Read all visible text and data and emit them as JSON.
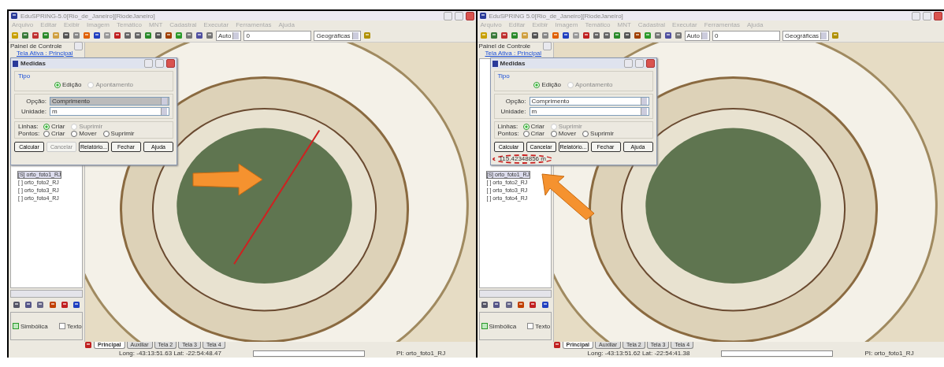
{
  "panels": [
    {
      "window": {
        "title": "EduSPRING-5.0[Rio_de_Janeiro][RiodeJaneiro]"
      },
      "menu": [
        "Arquivo",
        "Editar",
        "Exibir",
        "Imagem",
        "Temático",
        "MNT",
        "Cadastral",
        "Executar",
        "Ferramentas",
        "Ajuda"
      ],
      "toolbar": {
        "scale": "Auto",
        "value": "0",
        "projection": "Geográficas"
      },
      "control_panel": {
        "title": "Painel de Controle",
        "active_screen": "Tela Ativa : Principal",
        "layers": [
          {
            "label": "[S] orto_foto1_RJ",
            "selected": true
          },
          {
            "label": "[ ] orto_foto2_RJ",
            "selected": false
          },
          {
            "label": "[ ] orto_foto3_RJ",
            "selected": false
          },
          {
            "label": "[ ] orto_foto4_RJ",
            "selected": false
          }
        ],
        "options": [
          {
            "label": "Simbólica",
            "checked": true
          },
          {
            "label": "Texto",
            "checked": false
          }
        ]
      },
      "dialog": {
        "title": "Medidas",
        "group_title": "Tipo",
        "type_options": [
          {
            "label": "Edição",
            "selected": true,
            "disabled": false
          },
          {
            "label": "Apontamento",
            "selected": false,
            "disabled": true
          }
        ],
        "fields": [
          {
            "label": "Opção:",
            "value": "Comprimento",
            "focused": true
          },
          {
            "label": "Unidade:",
            "value": "m",
            "focused": false
          }
        ],
        "rows": [
          {
            "label": "Linhas:",
            "options": [
              {
                "label": "Criar",
                "selected": true,
                "disabled": false
              },
              {
                "label": "Suprimir",
                "selected": false,
                "disabled": true
              }
            ]
          },
          {
            "label": "Pontos:",
            "options": [
              {
                "label": "Criar",
                "selected": false,
                "disabled": false
              },
              {
                "label": "Mover",
                "selected": false,
                "disabled": false
              },
              {
                "label": "Suprimir",
                "selected": false,
                "disabled": false
              }
            ]
          }
        ],
        "buttons": [
          {
            "label": "Calcular",
            "disabled": false
          },
          {
            "label": "Cancelar",
            "disabled": true
          },
          {
            "label": "Relatório...",
            "disabled": false
          },
          {
            "label": "Fechar",
            "disabled": false
          },
          {
            "label": "Ajuda",
            "disabled": false
          }
        ]
      },
      "view_tabs": [
        {
          "label": "Principal",
          "selected": true
        },
        {
          "label": "Auxiliar",
          "selected": false
        },
        {
          "label": "Tela 2",
          "selected": false
        },
        {
          "label": "Tela 3",
          "selected": false
        },
        {
          "label": "Tela 4",
          "selected": false
        }
      ],
      "status": {
        "coordinates": "Long: -43:13:51.63 Lat: -22:54:48.47",
        "progress": {
          "level": 0
        },
        "layer": "PI: orto_foto1_RJ"
      },
      "annotation": {
        "measure_line": true,
        "kind": "map"
      }
    },
    {
      "window": {
        "title": "EduSPRING 5.0[Rio_de_Janeiro][RiodeJaneiro]"
      },
      "menu": [
        "Arquivo",
        "Editar",
        "Exibir",
        "Imagem",
        "Temático",
        "MNT",
        "Cadastral",
        "Executar",
        "Ferramentas",
        "Ajuda"
      ],
      "toolbar": {
        "scale": "Auto",
        "value": "0",
        "projection": "Geográficas"
      },
      "control_panel": {
        "title": "Painel de Controle",
        "active_screen": "Tela Ativa : Principal",
        "layers": [
          {
            "label": "[S] orto_foto1_RJ",
            "selected": true
          },
          {
            "label": "[ ] orto_foto2_RJ",
            "selected": false
          },
          {
            "label": "[ ] orto_foto3_RJ",
            "selected": false
          },
          {
            "label": "[ ] orto_foto4_RJ",
            "selected": false
          }
        ],
        "options": [
          {
            "label": "Simbólica",
            "checked": true
          },
          {
            "label": "Texto",
            "checked": false
          }
        ]
      },
      "dialog": {
        "title": "Medidas",
        "group_title": "Tipo",
        "type_options": [
          {
            "label": "Edição",
            "selected": true,
            "disabled": false
          },
          {
            "label": "Apontamento",
            "selected": false,
            "disabled": true
          }
        ],
        "fields": [
          {
            "label": "Opção:",
            "value": "Comprimento",
            "focused": false
          },
          {
            "label": "Unidade:",
            "value": "m",
            "focused": false
          }
        ],
        "rows": [
          {
            "label": "Linhas:",
            "options": [
              {
                "label": "Criar",
                "selected": true,
                "disabled": false
              },
              {
                "label": "Suprimir",
                "selected": false,
                "disabled": true
              }
            ]
          },
          {
            "label": "Pontos:",
            "options": [
              {
                "label": "Criar",
                "selected": false,
                "disabled": false
              },
              {
                "label": "Mover",
                "selected": false,
                "disabled": false
              },
              {
                "label": "Suprimir",
                "selected": false,
                "disabled": false
              }
            ]
          }
        ],
        "buttons": [
          {
            "label": "Calcular",
            "disabled": false
          },
          {
            "label": "Cancelar",
            "disabled": false
          },
          {
            "label": "Relatório...",
            "disabled": false
          },
          {
            "label": "Fechar",
            "disabled": false
          },
          {
            "label": "Ajuda",
            "disabled": false
          }
        ],
        "result": "115.42348856 m"
      },
      "view_tabs": [
        {
          "label": "Principal",
          "selected": true
        },
        {
          "label": "Auxiliar",
          "selected": false
        },
        {
          "label": "Tela 2",
          "selected": false
        },
        {
          "label": "Tela 3",
          "selected": false
        },
        {
          "label": "Tela 4",
          "selected": false
        }
      ],
      "status": {
        "coordinates": "Long: -43:13:51.62 Lat: -22:54:41.38",
        "progress": {
          "level": 0
        },
        "layer": "PI: orto_foto1_RJ"
      },
      "annotation": {
        "measure_line": false,
        "kind": "result"
      }
    }
  ]
}
